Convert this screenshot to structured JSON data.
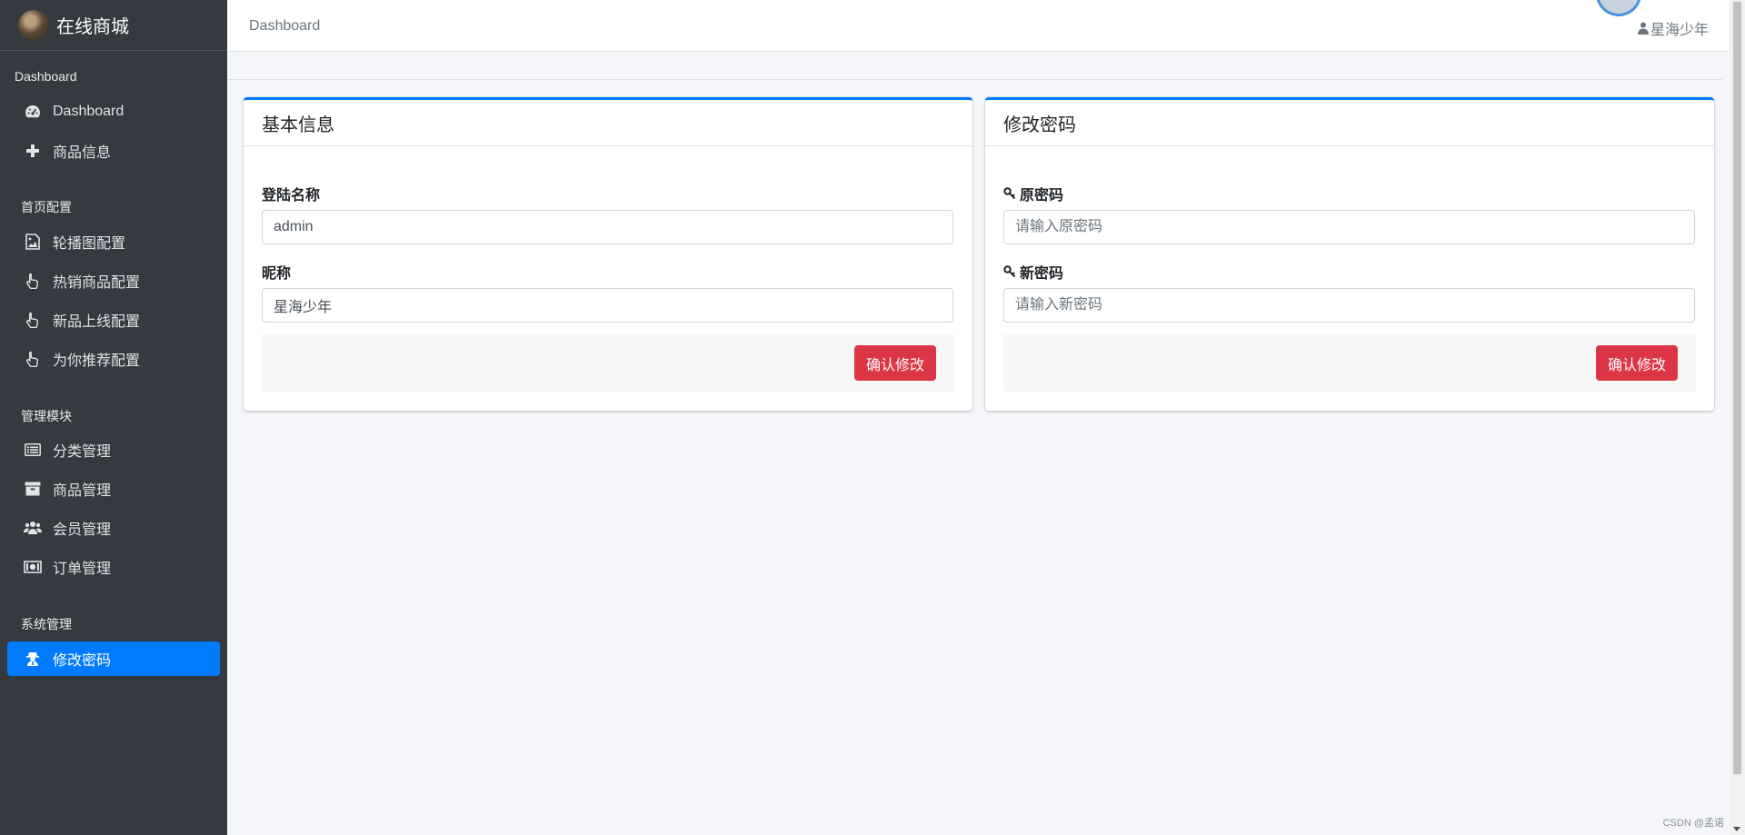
{
  "brand": {
    "title": "在线商城"
  },
  "sidebar": {
    "section_dashboard": "Dashboard",
    "items_top": [
      {
        "label": "Dashboard",
        "icon": "tachometer-icon"
      },
      {
        "label": "商品信息",
        "icon": "plus-icon"
      }
    ],
    "section_home": "首页配置",
    "items_home": [
      {
        "label": "轮播图配置",
        "icon": "image-icon"
      },
      {
        "label": "热销商品配置",
        "icon": "hand-pointer-icon"
      },
      {
        "label": "新品上线配置",
        "icon": "hand-pointer-icon"
      },
      {
        "label": "为你推荐配置",
        "icon": "hand-pointer-icon"
      }
    ],
    "section_manage": "管理模块",
    "items_manage": [
      {
        "label": "分类管理",
        "icon": "list-icon"
      },
      {
        "label": "商品管理",
        "icon": "archive-icon"
      },
      {
        "label": "会员管理",
        "icon": "users-icon"
      },
      {
        "label": "订单管理",
        "icon": "money-icon"
      }
    ],
    "section_system": "系统管理",
    "items_system": [
      {
        "label": "修改密码",
        "icon": "user-secret-icon",
        "active": true
      }
    ]
  },
  "topbar": {
    "breadcrumb": "Dashboard",
    "username": "星海少年"
  },
  "basic_info": {
    "title": "基本信息",
    "login_name_label": "登陆名称",
    "login_name_value": "admin",
    "nickname_label": "昵称",
    "nickname_value": "星海少年",
    "submit_label": "确认修改"
  },
  "change_password": {
    "title": "修改密码",
    "old_password_label": "原密码",
    "old_password_placeholder": "请输入原密码",
    "new_password_label": "新密码",
    "new_password_placeholder": "请输入新密码",
    "submit_label": "确认修改"
  },
  "watermark": "CSDN @孟诺",
  "colors": {
    "sidebar_bg": "#343a40",
    "accent": "#007bff",
    "danger": "#dc3545",
    "page_bg": "#f4f6f9"
  }
}
